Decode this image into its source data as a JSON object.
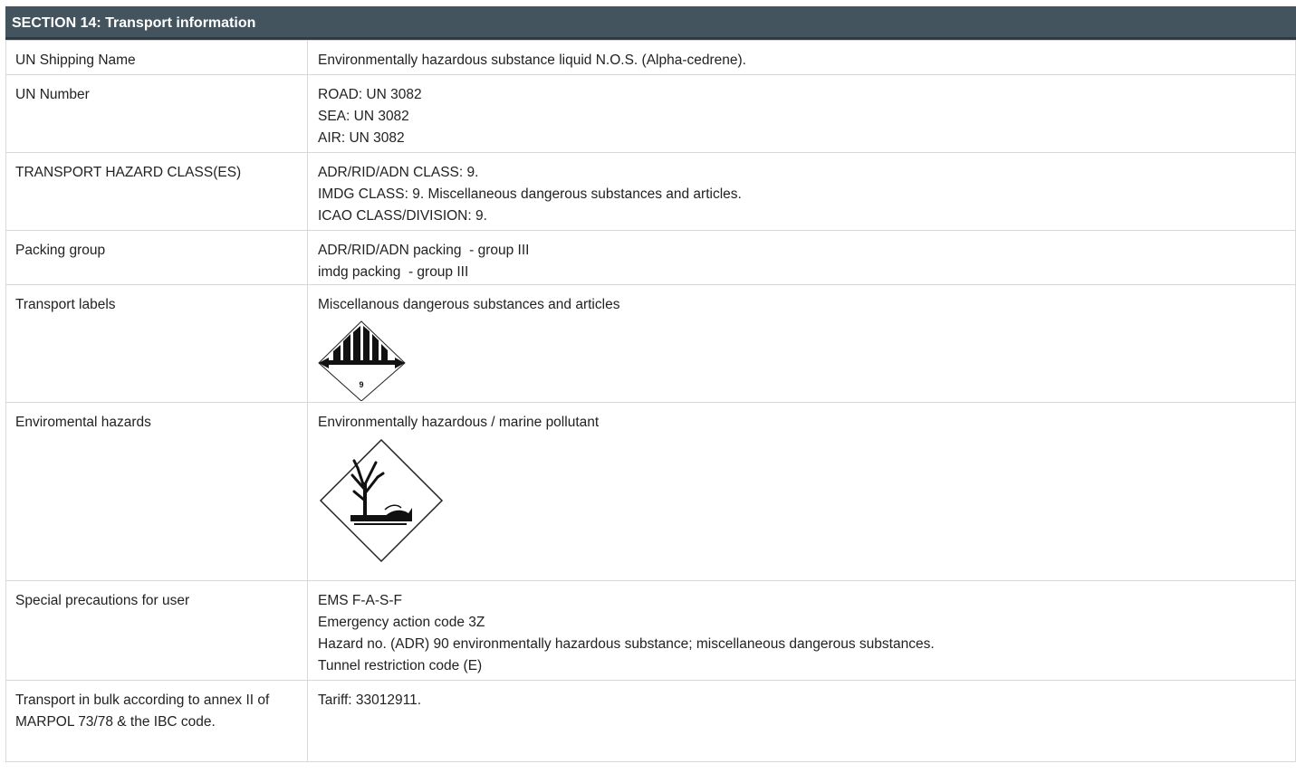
{
  "section": {
    "title": "SECTION 14: Transport information"
  },
  "rows": [
    {
      "label": "UN Shipping Name",
      "lines": [
        "Environmentally hazardous substance liquid N.O.S. (Alpha-cedrene)."
      ]
    },
    {
      "label": "UN Number",
      "lines": [
        "ROAD: UN 3082",
        "SEA: UN 3082",
        "AIR: UN 3082"
      ]
    },
    {
      "label": "TRANSPORT HAZARD CLASS(ES)",
      "lines": [
        "ADR/RID/ADN CLASS: 9.",
        "IMDG CLASS: 9. Miscellaneous dangerous substances and articles.",
        "ICAO CLASS/DIVISION: 9."
      ]
    },
    {
      "label": "Packing group",
      "lines": [
        "ADR/RID/ADN packing  - group III",
        "imdg packing  - group III"
      ]
    },
    {
      "label": "Transport labels",
      "lines": [
        "Miscellanous dangerous substances and articles"
      ],
      "pictogram": {
        "name": "class-9-hazard-label-icon",
        "number": "9"
      }
    },
    {
      "label": "Enviromental hazards",
      "lines": [
        "Environmentally hazardous / marine pollutant"
      ],
      "pictogram": {
        "name": "environmental-hazard-icon"
      }
    },
    {
      "label": "Special precautions for user",
      "lines": [
        "EMS F-A-S-F",
        "Emergency action code 3Z",
        "Hazard no. (ADR) 90 environmentally hazardous substance; miscellaneous dangerous substances.",
        "Tunnel restriction code (E)"
      ]
    },
    {
      "label": "Transport in bulk according to annex II of MARPOL 73/78 & the IBC code.",
      "lines": [
        "Tariff: 33012911."
      ]
    }
  ],
  "colors": {
    "header_bg": "#44545f",
    "header_text": "#ffffff",
    "border": "#d8d8d8"
  }
}
